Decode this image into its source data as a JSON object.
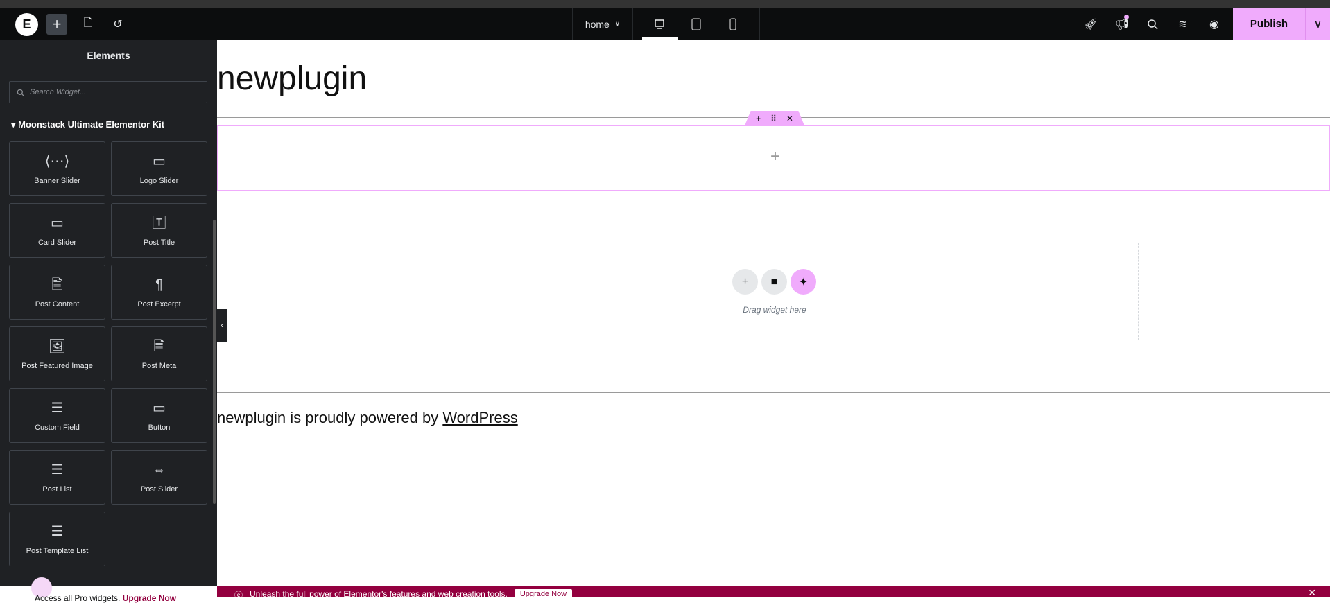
{
  "toolbar": {
    "logo": "E",
    "add": "+",
    "page_dropdown": "home",
    "publish": "Publish"
  },
  "sidebar": {
    "title": "Elements",
    "search_placeholder": "Search Widget...",
    "category": "Moonstack Ultimate Elementor Kit",
    "widgets": [
      {
        "label": "Banner Slider",
        "icon": "⟨⋯⟩"
      },
      {
        "label": "Logo Slider",
        "icon": "▭"
      },
      {
        "label": "Card Slider",
        "icon": "▭"
      },
      {
        "label": "Post Title",
        "icon": "🅃"
      },
      {
        "label": "Post Content",
        "icon": "🗎"
      },
      {
        "label": "Post Excerpt",
        "icon": "¶"
      },
      {
        "label": "Post Featured Image",
        "icon": "🖼"
      },
      {
        "label": "Post Meta",
        "icon": "🗎"
      },
      {
        "label": "Custom Field",
        "icon": "☰"
      },
      {
        "label": "Button",
        "icon": "▭"
      },
      {
        "label": "Post List",
        "icon": "☰"
      },
      {
        "label": "Post Slider",
        "icon": "⇔"
      },
      {
        "label": "Post Template List",
        "icon": "☰"
      }
    ],
    "promo_text": "Access all Pro widgets.",
    "promo_link": "Upgrade Now"
  },
  "canvas": {
    "site_title": "newplugin",
    "drag_text": "Drag widget here",
    "footer_prefix": "newplugin is proudly powered by ",
    "footer_link": "WordPress"
  },
  "banner": {
    "text": "Unleash the full power of Elementor's features and web creation tools.",
    "button": "Upgrade Now"
  }
}
